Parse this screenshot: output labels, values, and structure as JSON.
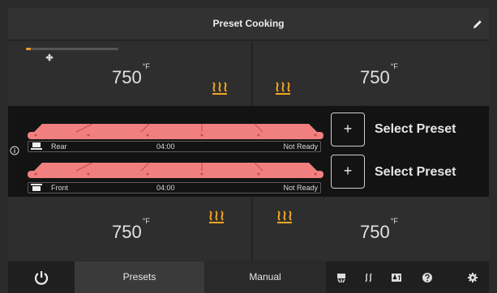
{
  "header": {
    "title": "Preset Cooking",
    "edit_icon": "pencil-icon"
  },
  "progress": {
    "fraction": 0.05,
    "accent": "#ff9a1f"
  },
  "zones": {
    "top_left": {
      "temp": "750",
      "unit": "°F"
    },
    "top_right": {
      "temp": "750",
      "unit": "°F"
    },
    "bottom_left": {
      "temp": "750",
      "unit": "°F"
    },
    "bottom_right": {
      "temp": "750",
      "unit": "°F"
    }
  },
  "platens": [
    {
      "position": "Rear",
      "time": "04:00",
      "status": "Not Ready",
      "select_label": "Select Preset",
      "add_symbol": "+"
    },
    {
      "position": "Front",
      "time": "04:00",
      "status": "Not Ready",
      "select_label": "Select Preset",
      "add_symbol": "+"
    }
  ],
  "footer": {
    "power_icon": "power-icon",
    "tabs": [
      {
        "label": "Presets",
        "active": true
      },
      {
        "label": "Manual",
        "active": false
      }
    ],
    "icons": [
      "cleaning-icon",
      "steam-icon",
      "translate-icon",
      "help-icon",
      "settings-icon"
    ]
  },
  "colors": {
    "heat": "#f5a623",
    "platen": "#f08080",
    "platen_dark": "#e05a5a"
  }
}
